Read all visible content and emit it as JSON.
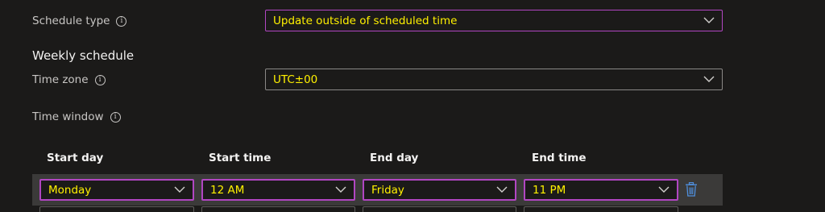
{
  "schedule_type": {
    "label": "Schedule type",
    "info_icon": "i",
    "value": "Update outside of scheduled time"
  },
  "weekly_schedule": {
    "title": "Weekly schedule"
  },
  "time_zone": {
    "label": "Time zone",
    "info_icon": "i",
    "value": "UTC±00"
  },
  "time_window": {
    "label": "Time window",
    "info_icon": "i"
  },
  "table": {
    "columns": [
      "Start day",
      "Start time",
      "End day",
      "End time"
    ],
    "rows": [
      {
        "start_day": "Monday",
        "start_time": "12 AM",
        "end_day": "Friday",
        "end_time": "11 PM"
      }
    ]
  },
  "icons": {
    "chevron": "chevron-down-icon",
    "delete": "trash-icon",
    "info": "info-icon"
  },
  "colors": {
    "background": "#1b1a19",
    "value_text": "#fff100",
    "focus_border": "#b146c2",
    "row_highlight": "#3b3a39",
    "delete_icon": "#4f8fdd"
  }
}
